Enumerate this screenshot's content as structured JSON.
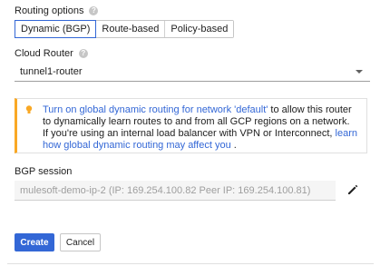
{
  "routing": {
    "label": "Routing options",
    "options": [
      "Dynamic (BGP)",
      "Route-based",
      "Policy-based"
    ],
    "selected": "Dynamic (BGP)"
  },
  "cloud_router": {
    "label": "Cloud Router",
    "value": "tunnel1-router"
  },
  "warning": {
    "link1": "Turn on global dynamic routing for network 'default'",
    "text1": " to allow this router to dynamically learn routes to and from all GCP regions on a network. If you're using an internal load balancer with VPN or Interconnect, ",
    "link2": "learn how global dynamic routing may affect you",
    "text2": " ."
  },
  "bgp": {
    "label": "BGP session",
    "value": "mulesoft-demo-ip-2 (IP: 169.254.100.82 Peer IP: 169.254.100.81)"
  },
  "actions": {
    "create": "Create",
    "cancel": "Cancel"
  },
  "colors": {
    "accent": "#3367d6",
    "warning": "#f9a825"
  }
}
